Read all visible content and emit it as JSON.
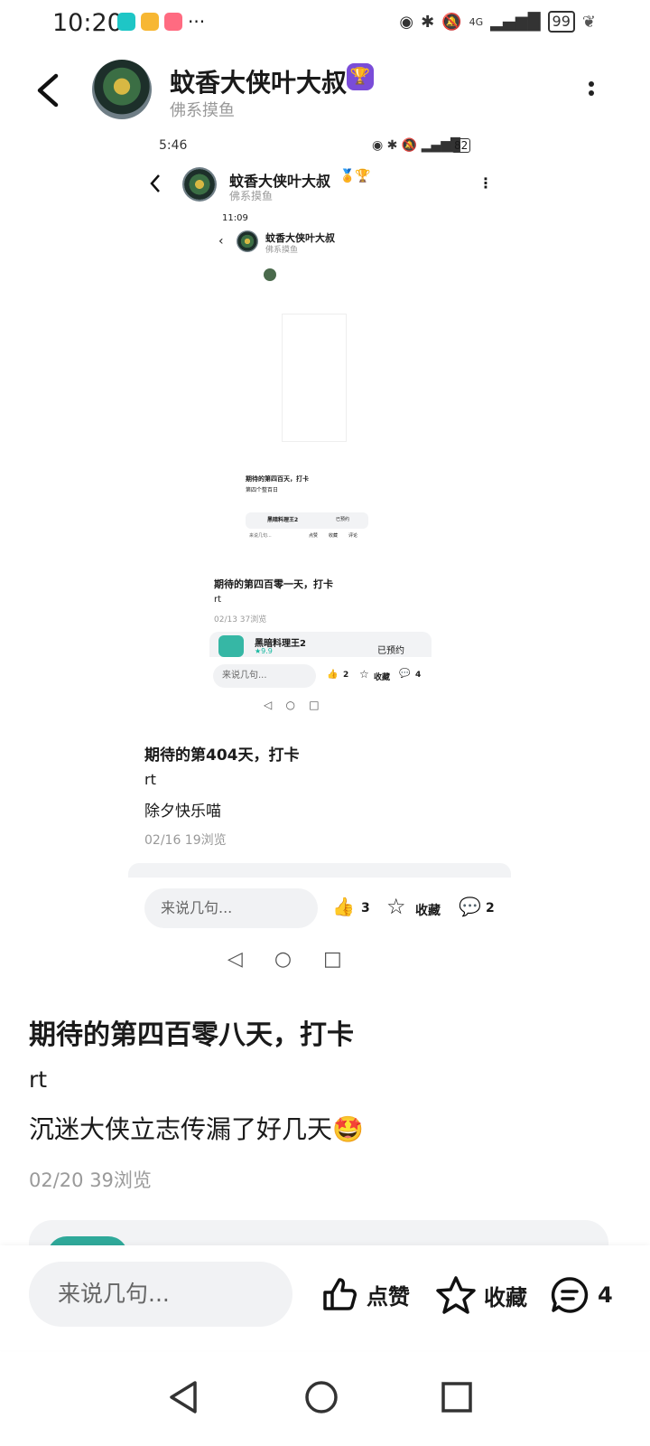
{
  "status_bar": {
    "time": "10:20",
    "battery": "99",
    "signal": "4G"
  },
  "header": {
    "name": "蚊香大侠叶大叔",
    "subtitle": "佛系摸鱼"
  },
  "nested1": {
    "time": "5:46",
    "battery": "82",
    "name": "蚊香大侠叶大叔",
    "subtitle": "佛系摸鱼",
    "post_title": "期待的第404天，打卡",
    "line1": "rt",
    "line2": "除夕快乐喵",
    "meta": "02/16  19浏览",
    "comment_placeholder": "来说几句...",
    "like_count": "3",
    "fav_label": "收藏",
    "comment_count": "2"
  },
  "nested2": {
    "time": "11:09",
    "name": "蚊香大侠叶大叔",
    "subtitle": "佛系摸鱼",
    "post_title": "期待的第四百零一天，打卡",
    "line1": "rt",
    "meta": "02/13  37浏览",
    "game_name": "黑暗料理王2",
    "game_rating": "★9.9",
    "game_button": "已预约",
    "comment_placeholder": "来说几句...",
    "like_count": "2",
    "fav_label": "收藏",
    "comment_count": "4"
  },
  "nested3": {
    "post_title": "期待的第四百天，打卡",
    "line1": "第四个整百日",
    "game_name": "黑暗料理王2",
    "game_button": "已预约",
    "comment_placeholder": "来说几句...",
    "like_label": "点赞",
    "fav_label": "收藏",
    "comment_label": "评论"
  },
  "post": {
    "title": "期待的第四百零八天，打卡",
    "line1": "rt",
    "line2": "沉迷大侠立志传漏了好几天🤩",
    "meta": "02/20  39浏览"
  },
  "bottom_bar": {
    "comment_placeholder": "来说几句...",
    "like_label": "点赞",
    "fav_label": "收藏",
    "comment_count": "4"
  }
}
